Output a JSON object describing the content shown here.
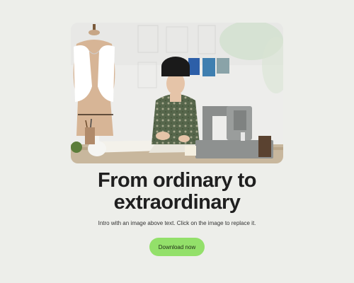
{
  "hero": {
    "image_alt": "Woman sewing at a desk with a sewing machine and dress form",
    "title_line1": "From ordinary to",
    "title_line2": "extraordinary",
    "intro": "Intro with an image above text. Click on the image to replace it.",
    "cta_label": "Download now"
  },
  "colors": {
    "background": "#edeeea",
    "accent": "#93e06a",
    "text": "#1f1f1f"
  }
}
